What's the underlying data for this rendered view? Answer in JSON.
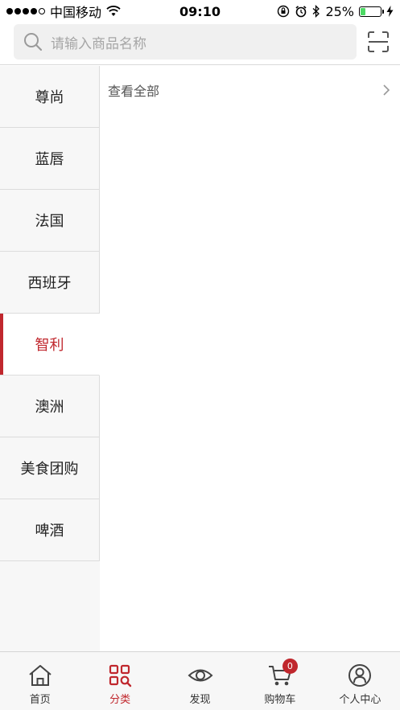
{
  "status_bar": {
    "carrier": "中国移动",
    "time": "09:10",
    "battery": "25%",
    "battery_level": 0.25,
    "icons": [
      "signal-icon",
      "wifi-icon",
      "orientation-lock-icon",
      "alarm-icon",
      "bluetooth-icon",
      "battery-icon",
      "charging-icon"
    ]
  },
  "search": {
    "placeholder": "请输入商品名称",
    "icons": [
      "search-icon",
      "scan-icon"
    ]
  },
  "sidebar": {
    "items": [
      {
        "label": "尊尚"
      },
      {
        "label": "蓝唇"
      },
      {
        "label": "法国"
      },
      {
        "label": "西班牙"
      },
      {
        "label": "智利",
        "active": true
      },
      {
        "label": "澳洲"
      },
      {
        "label": "美食团购"
      },
      {
        "label": "啤酒"
      }
    ]
  },
  "content": {
    "view_all": "查看全部",
    "view_all_icon": "chevron-right-icon"
  },
  "tab_bar": {
    "tabs": [
      {
        "label": "首页",
        "icon": "home-icon"
      },
      {
        "label": "分类",
        "icon": "category-icon",
        "active": true
      },
      {
        "label": "发现",
        "icon": "eye-icon"
      },
      {
        "label": "购物车",
        "icon": "cart-icon",
        "badge": "0"
      },
      {
        "label": "个人中心",
        "icon": "user-icon"
      }
    ]
  },
  "colors": {
    "accent": "#c0272d",
    "sidebar_bg": "#f7f7f7",
    "search_bg": "#f0f0f0",
    "battery_fill": "#4cd964"
  }
}
